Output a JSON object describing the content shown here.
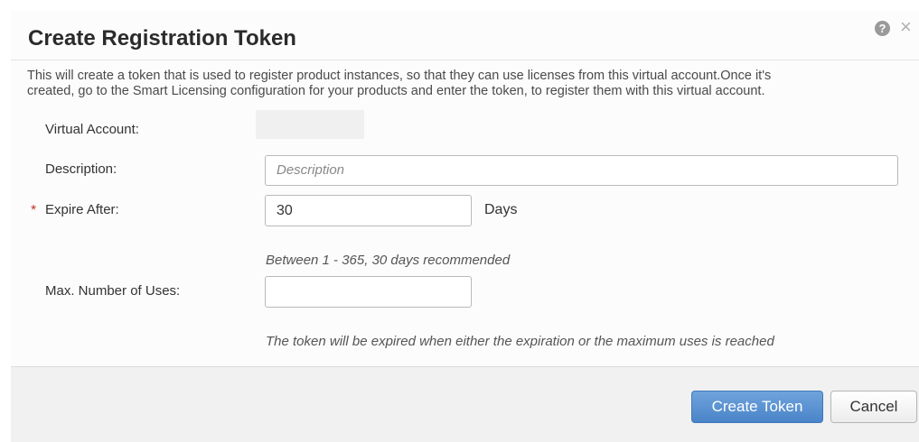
{
  "dialog": {
    "title": "Create Registration Token",
    "help_icon_glyph": "?",
    "close_icon_glyph": "×",
    "intro_line1": "This will create a token that is used to register product instances, so that they can use licenses from this virtual account.Once it's",
    "intro_line2": "created, go to the Smart Licensing configuration for your products and enter the token, to register them with this virtual account."
  },
  "form": {
    "virtual_account": {
      "label": "Virtual Account:",
      "value": ""
    },
    "description": {
      "label": "Description:",
      "placeholder": "Description",
      "value": ""
    },
    "expire_after": {
      "required_marker": "*",
      "label": "Expire After:",
      "value": "30",
      "unit": "Days",
      "hint": "Between 1 - 365, 30 days recommended"
    },
    "max_uses": {
      "label": "Max. Number of Uses:",
      "value": "",
      "hint": "The token will be expired when either the expiration or the maximum uses is reached"
    }
  },
  "footer": {
    "create_label": "Create Token",
    "cancel_label": "Cancel"
  },
  "colors": {
    "primary_button": "#4a84c8",
    "required_marker": "#c0392b"
  }
}
